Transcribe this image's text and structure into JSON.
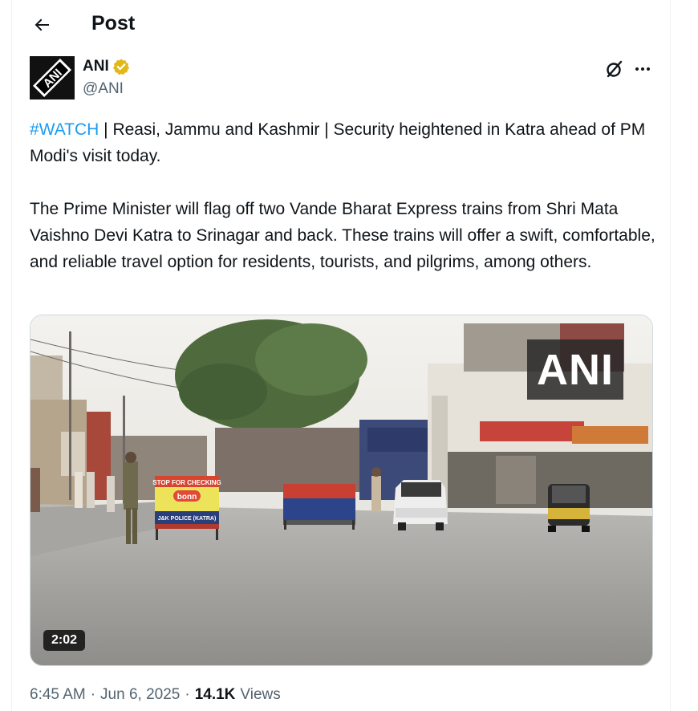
{
  "header": {
    "title": "Post",
    "back_icon": "arrow-left-icon"
  },
  "author": {
    "name": "ANI",
    "handle": "@ANI",
    "verified": true,
    "verified_color": "#e2b719",
    "avatar_text": "ANI"
  },
  "actions": {
    "grok_icon": "grok-icon",
    "more_icon": "more-horizontal-icon"
  },
  "tweet": {
    "hashtag": "#WATCH",
    "line1_rest": " | Reasi, Jammu and Kashmir | Security heightened in Katra ahead of PM Modi's visit today.",
    "paragraph2": "The Prime Minister will flag off two Vande Bharat Express trains from Shri Mata Vaishno Devi Katra to Srinagar and back. These trains will offer a swift, comfortable, and reliable travel option for residents, tourists, and pilgrims, among others."
  },
  "media": {
    "duration": "2:02",
    "watermark": "ANI",
    "signs": {
      "stop_checking": "STOP FOR CHECKING",
      "bonn": "bonn",
      "police": "J&K POLICE (KATRA)"
    }
  },
  "meta": {
    "time": "6:45 AM",
    "separator": "·",
    "date": "Jun 6, 2025",
    "views_count": "14.1K",
    "views_label": "Views"
  },
  "colors": {
    "accent": "#1d9bf0",
    "secondary_text": "#536471",
    "text": "#0f1419"
  }
}
